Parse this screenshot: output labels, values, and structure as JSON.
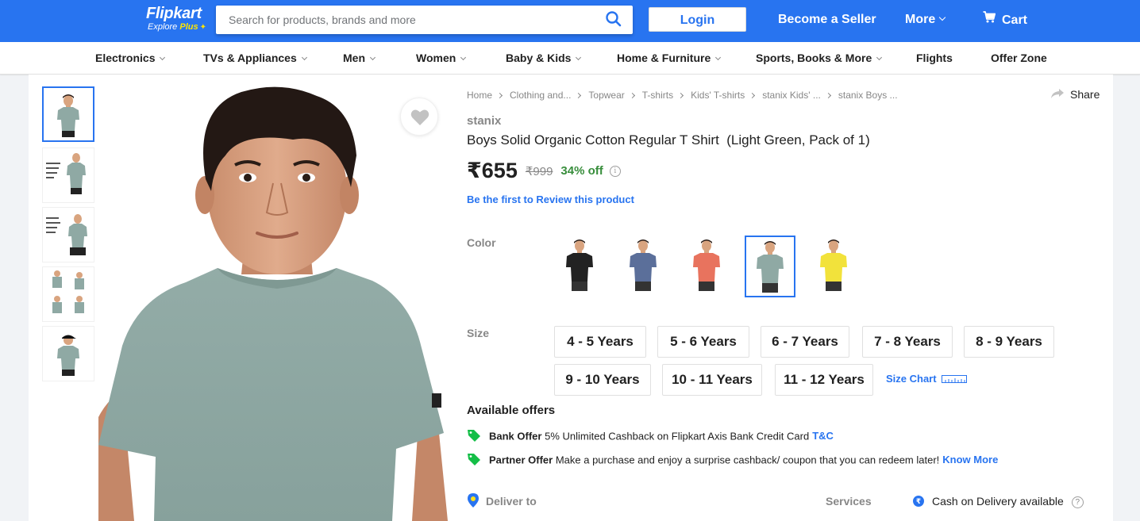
{
  "header": {
    "logo_text": "Flipkart",
    "logo_tag_prefix": "Explore",
    "logo_tag_plus": "Plus",
    "search_placeholder": "Search for products, brands and more",
    "login_label": "Login",
    "seller_label": "Become a Seller",
    "more_label": "More",
    "cart_label": "Cart",
    "brand_color": "#2874f0"
  },
  "categories": [
    {
      "label": "Electronics",
      "has_dropdown": true
    },
    {
      "label": "TVs & Appliances",
      "has_dropdown": true
    },
    {
      "label": "Men",
      "has_dropdown": true
    },
    {
      "label": "Women",
      "has_dropdown": true
    },
    {
      "label": "Baby & Kids",
      "has_dropdown": true
    },
    {
      "label": "Home & Furniture",
      "has_dropdown": true
    },
    {
      "label": "Sports, Books & More",
      "has_dropdown": true
    },
    {
      "label": "Flights",
      "has_dropdown": false
    },
    {
      "label": "Offer Zone",
      "has_dropdown": false
    }
  ],
  "breadcrumb": [
    "Home",
    "Clothing and...",
    "Topwear",
    "T-shirts",
    "Kids' T-shirts",
    "stanix Kids' ...",
    "stanix Boys ..."
  ],
  "share_label": "Share",
  "product": {
    "brand": "stanix",
    "title": "Boys Solid Organic Cotton Regular T Shirt  (Light Green, Pack of 1)",
    "price": "₹655",
    "mrp": "₹999",
    "discount": "34% off",
    "review_link": "Be the first to Review this product"
  },
  "thumbnails": [
    {
      "name": "thumb-1",
      "shirt": "#8fa9a4",
      "active": true
    },
    {
      "name": "thumb-2",
      "shirt": "#8fa9a4",
      "active": false
    },
    {
      "name": "thumb-3",
      "shirt": "#8fa9a4",
      "active": false
    },
    {
      "name": "thumb-4",
      "shirt": "#8fa9a4",
      "active": false
    },
    {
      "name": "thumb-5",
      "shirt": "#8fa9a4",
      "active": false
    }
  ],
  "color": {
    "label": "Color",
    "options": [
      {
        "name": "black",
        "hex": "#222222",
        "selected": false
      },
      {
        "name": "blue",
        "hex": "#5b6f9a",
        "selected": false
      },
      {
        "name": "coral",
        "hex": "#e8735e",
        "selected": false
      },
      {
        "name": "light-green",
        "hex": "#8fa9a4",
        "selected": true
      },
      {
        "name": "yellow",
        "hex": "#f2e23b",
        "selected": false
      }
    ]
  },
  "size": {
    "label": "Size",
    "options": [
      "4 - 5 Years",
      "5 - 6 Years",
      "6 - 7 Years",
      "7 - 8 Years",
      "8 - 9 Years",
      "9 - 10 Years",
      "10 - 11 Years",
      "11 - 12 Years"
    ],
    "size_chart_label": "Size Chart"
  },
  "offers": {
    "title": "Available offers",
    "items": [
      {
        "kind": "Bank Offer",
        "text": "5% Unlimited Cashback on Flipkart Axis Bank Credit Card",
        "link": "T&C"
      },
      {
        "kind": "Partner Offer",
        "text": "Make a purchase and enjoy a surprise cashback/ coupon that you can redeem later!",
        "link": "Know More"
      }
    ]
  },
  "delivery": {
    "deliver_to_label": "Deliver to",
    "services_label": "Services",
    "cod_text": "Cash on Delivery available"
  }
}
